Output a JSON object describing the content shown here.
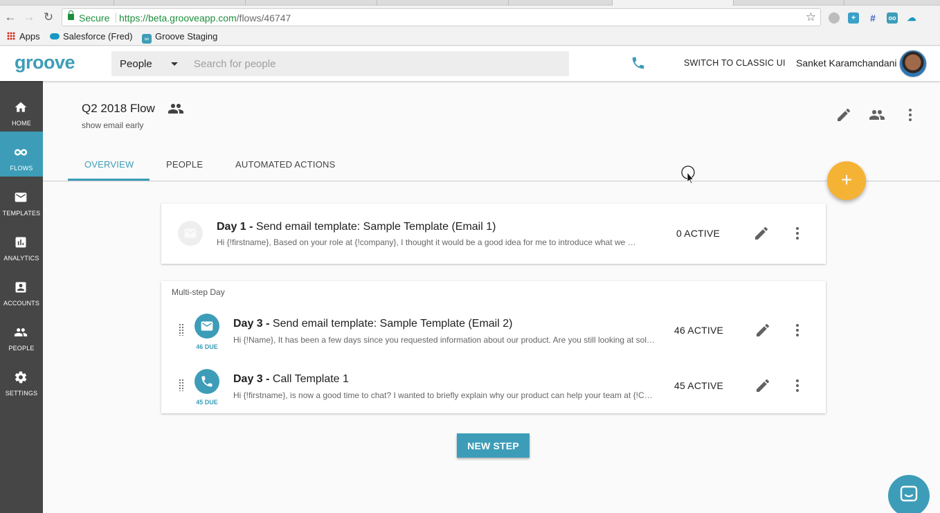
{
  "browser": {
    "secure_label": "Secure",
    "url_host": "https://beta.grooveapp.com",
    "url_path": "/flows/46747",
    "bookmarks": [
      {
        "label": "Apps"
      },
      {
        "label": "Salesforce (Fred)"
      },
      {
        "label": "Groove Staging"
      }
    ]
  },
  "header": {
    "logo": "groove",
    "search_scope": "People",
    "search_placeholder": "Search for people",
    "switch_label": "SWITCH TO CLASSIC UI",
    "user_name": "Sanket Karamchandani"
  },
  "sidebar": {
    "items": [
      {
        "label": "HOME",
        "icon": "home-icon"
      },
      {
        "label": "FLOWS",
        "icon": "infinity-icon",
        "active": true
      },
      {
        "label": "TEMPLATES",
        "icon": "mail-icon"
      },
      {
        "label": "ANALYTICS",
        "icon": "bar-chart-icon"
      },
      {
        "label": "ACCOUNTS",
        "icon": "account-box-icon"
      },
      {
        "label": "PEOPLE",
        "icon": "people-icon"
      },
      {
        "label": "SETTINGS",
        "icon": "gear-icon"
      }
    ]
  },
  "flow": {
    "title": "Q2 2018 Flow",
    "subtitle": "show email early",
    "tabs": [
      {
        "label": "OVERVIEW",
        "active": true
      },
      {
        "label": "PEOPLE"
      },
      {
        "label": "AUTOMATED ACTIONS"
      }
    ]
  },
  "steps": {
    "single": {
      "day": "Day 1 -",
      "title": "Send email template: Sample Template (Email 1)",
      "preview": "Hi {!firstname}, Based on your role at {!company}, I thought it would be a good idea for me to introduce what we do at our company",
      "active": "0 ACTIVE"
    },
    "multi_label": "Multi-step Day",
    "multi": [
      {
        "day": "Day 3 -",
        "title": "Send email template: Sample Template (Email 2)",
        "preview": "Hi {!Name}, It has been a few days since you requested information about our product. Are you still looking at solutions?",
        "due": "46 DUE",
        "active": "46 ACTIVE",
        "icon": "mail-icon"
      },
      {
        "day": "Day 3 -",
        "title": "Call Template 1",
        "preview": "Hi {!firstname}, is now a good time to chat? I wanted to briefly explain why our product can help your team at {!Company}",
        "due": "45 DUE",
        "active": "45 ACTIVE",
        "icon": "phone-icon"
      }
    ]
  },
  "actions": {
    "new_step": "NEW STEP",
    "fab": "+"
  },
  "colors": {
    "accent": "#3d9db8",
    "fab": "#f5b335",
    "sidebar": "#464646"
  }
}
